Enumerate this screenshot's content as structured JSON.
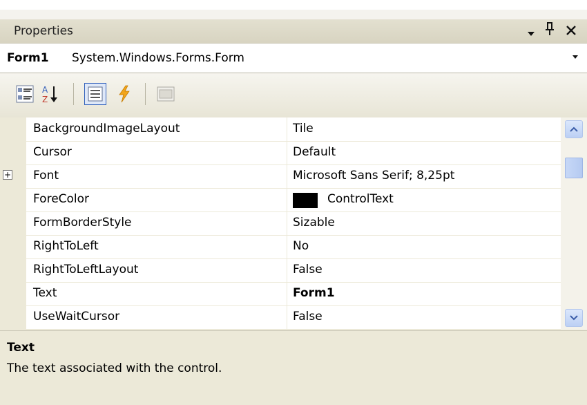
{
  "panel": {
    "title": "Properties",
    "controls": {
      "dropdown_icon": "chevron-down-icon",
      "pin_icon": "pin-icon",
      "close_icon": "close-icon"
    }
  },
  "object_selector": {
    "name": "Form1",
    "type": "System.Windows.Forms.Form"
  },
  "toolbar": {
    "buttons": [
      {
        "icon": "categorized-icon",
        "active": false
      },
      {
        "icon": "alphabetical-sort-icon",
        "active": false
      },
      {
        "icon": "properties-icon",
        "active": true
      },
      {
        "icon": "events-lightning-icon",
        "active": false
      },
      {
        "icon": "property-pages-icon",
        "active": false
      }
    ]
  },
  "properties": [
    {
      "name": "BackgroundImageLayout",
      "value": "Tile"
    },
    {
      "name": "Cursor",
      "value": "Default"
    },
    {
      "name": "Font",
      "value": "Microsoft Sans Serif; 8,25pt",
      "expandable": true
    },
    {
      "name": "ForeColor",
      "value": "ControlText",
      "swatch_color": "#000000"
    },
    {
      "name": "FormBorderStyle",
      "value": "Sizable"
    },
    {
      "name": "RightToLeft",
      "value": "No"
    },
    {
      "name": "RightToLeftLayout",
      "value": "False"
    },
    {
      "name": "Text",
      "value": "Form1",
      "bold": true
    },
    {
      "name": "UseWaitCursor",
      "value": "False"
    }
  ],
  "expand_glyph": "+",
  "description": {
    "title": "Text",
    "text": "The text associated with the control."
  }
}
